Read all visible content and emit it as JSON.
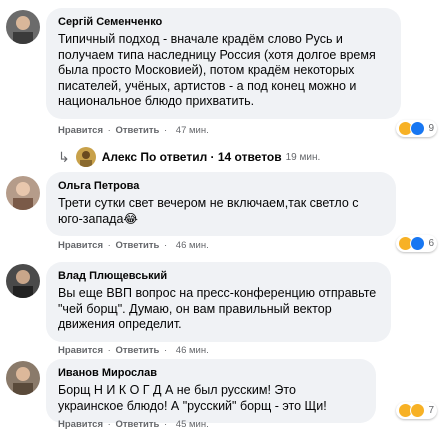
{
  "comments": [
    {
      "author": "Сергій Семенченко",
      "text": "Типичный подход - вначале крадём слово Русь и получаем типа наследницу Россия (хотя долгое время была просто Московией), потом крадём некоторых писателей, учёных, артистов - а под конец можно и национальное блюдо прихватить.",
      "like": "Нравится",
      "reply": "Ответить",
      "time": "47 мин.",
      "reactions_count": "9"
    },
    {
      "author": "Ольга Петрова",
      "text": "Трети сутки свет вечером не включаем,так светло с юго-запада😂",
      "like": "Нравится",
      "reply": "Ответить",
      "time": "46 мин.",
      "reactions_count": "6"
    },
    {
      "author": "Влад Плющевський",
      "text": "Вы еще ВВП вопрос на пресс-конференцию отправьте \"чей борщ\". Думаю, он вам правильный вектор движения определит.",
      "like": "Нравится",
      "reply": "Ответить",
      "time": "46 мин."
    },
    {
      "author": "Иванов Мирослав",
      "text": "Борщ Н И К О Г Д А не был русским! Это украинское блюдо! А \"русский\" борщ - это Щи!",
      "like": "Нравится",
      "reply": "Ответить",
      "time": "45 мин.",
      "reactions_count": "7"
    }
  ],
  "replies": {
    "label": "Алекс По ответил · 14 ответов",
    "time": "19 мин."
  },
  "sep": "·",
  "icons": {
    "reply_arrow": "reply-arrow-icon",
    "haha": "haha-emoji-icon",
    "like": "like-icon"
  },
  "colors": {
    "bubble": "#f0f2f5",
    "meta": "#65676b",
    "like_blue": "#1877f2",
    "haha_yellow": "#f7b125"
  }
}
